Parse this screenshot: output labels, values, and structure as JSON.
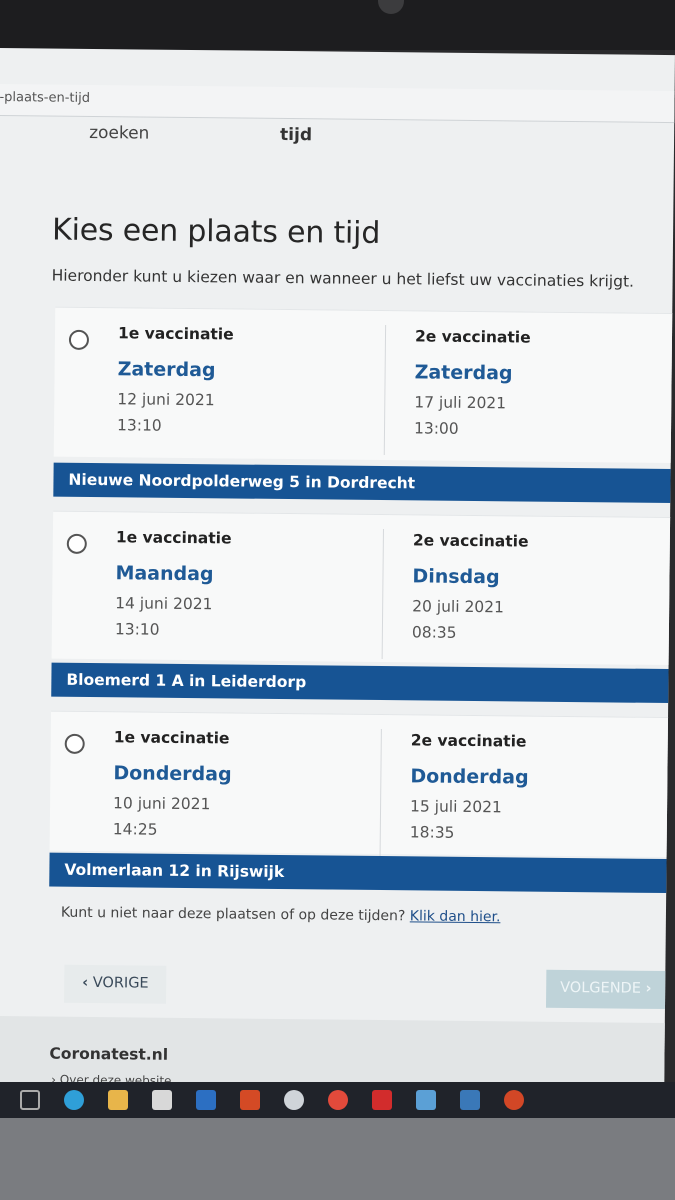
{
  "browser": {
    "url": "-plaats-en-tijd"
  },
  "steps": {
    "step1": "zoeken",
    "step2": "tijd"
  },
  "page": {
    "title": "Kies een plaats en tijd",
    "intro": "Hieronder kunt u kiezen waar en wanneer u het liefst uw vaccinaties krijgt."
  },
  "options": [
    {
      "first": {
        "label": "1e vaccinatie",
        "day": "Zaterdag",
        "date": "12 juni 2021",
        "time": "13:10"
      },
      "second": {
        "label": "2e vaccinatie",
        "day": "Zaterdag",
        "date": "17 juli 2021",
        "time": "13:00"
      },
      "location": "Nieuwe Noordpolderweg 5 in Dordrecht"
    },
    {
      "first": {
        "label": "1e vaccinatie",
        "day": "Maandag",
        "date": "14 juni 2021",
        "time": "13:10"
      },
      "second": {
        "label": "2e vaccinatie",
        "day": "Dinsdag",
        "date": "20 juli 2021",
        "time": "08:35"
      },
      "location": "Bloemerd 1 A in Leiderdorp"
    },
    {
      "first": {
        "label": "1e vaccinatie",
        "day": "Donderdag",
        "date": "10 juni 2021",
        "time": "14:25"
      },
      "second": {
        "label": "2e vaccinatie",
        "day": "Donderdag",
        "date": "15 juli 2021",
        "time": "18:35"
      },
      "location": "Volmerlaan 12 in Rijswijk"
    }
  ],
  "note": {
    "text": "Kunt u niet naar deze plaatsen of op deze tijden? ",
    "link": "Klik dan hier."
  },
  "nav": {
    "prev": "VORIGE",
    "next": "VOLGENDE"
  },
  "footer": {
    "site": "Coronatest.nl",
    "link": "Over deze website"
  },
  "taskbar": {
    "icons": [
      "task-view-icon",
      "edge-icon",
      "file-explorer-icon",
      "store-icon",
      "mail-icon",
      "office-icon",
      "weather-icon",
      "chrome-icon",
      "acrobat-icon",
      "notes-icon",
      "camera-icon",
      "powerpoint-icon"
    ]
  }
}
